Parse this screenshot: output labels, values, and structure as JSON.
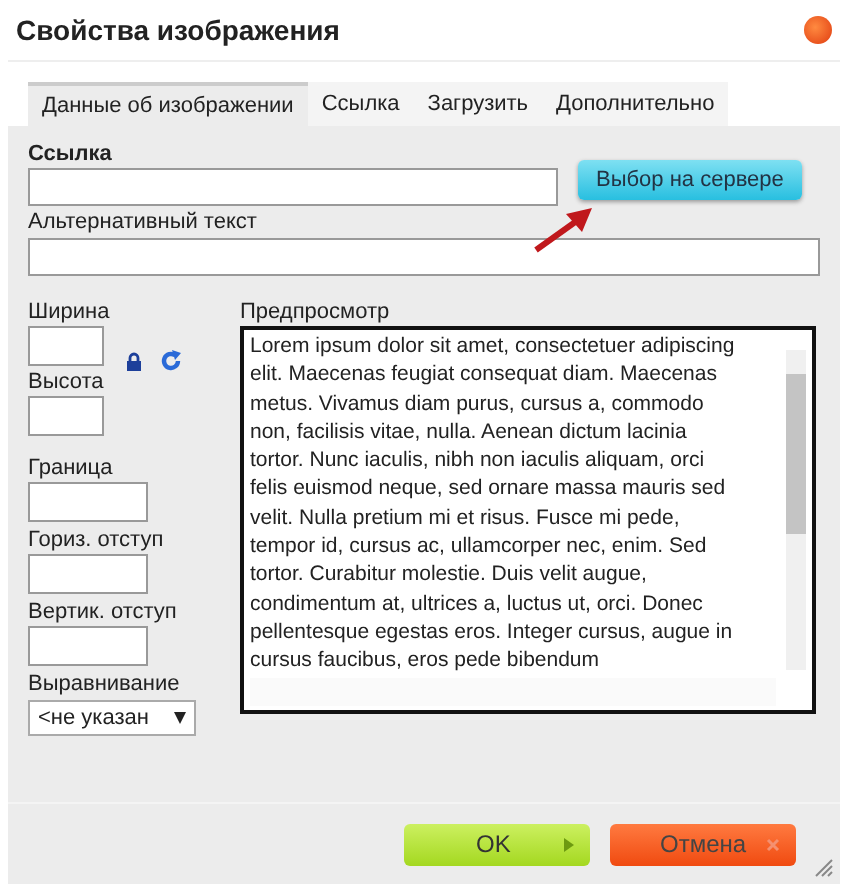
{
  "window": {
    "title": "Свойства изображения"
  },
  "tabs": [
    {
      "label": "Данные об изображении",
      "selected": true
    },
    {
      "label": "Ссылка",
      "selected": false
    },
    {
      "label": "Загрузить",
      "selected": false
    },
    {
      "label": "Дополнительно",
      "selected": false
    }
  ],
  "url": {
    "label": "Ссылка",
    "browse_button": "Выбор на сервере"
  },
  "alt": {
    "label": "Альтернативный текст"
  },
  "fields": [
    {
      "label": "Ширина"
    },
    {
      "label": "Высота"
    },
    {
      "label": "Граница"
    },
    {
      "label": "Гориз. отступ"
    },
    {
      "label": "Вертик. отступ"
    }
  ],
  "align": {
    "label": "Выравнивание",
    "value": "<не указан"
  },
  "preview": {
    "label": "Предпросмотр",
    "text": "Lorem ipsum dolor sit amet, consectetuer adipiscing elit. Maecenas feugiat consequat diam. Maecenas metus. Vivamus diam purus, cursus a, commodo non, facilisis vitae, nulla. Aenean dictum lacinia tortor. Nunc iaculis, nibh non iaculis aliquam, orci felis euismod neque, sed ornare massa mauris sed velit. Nulla pretium mi et risus. Fusce mi pede, tempor id, cursus ac, ullamcorper nec, enim. Sed tortor. Curabitur molestie. Duis velit augue, condimentum at, ultrices a, luctus ut, orci. Donec pellentesque egestas eros. Integer cursus, augue in cursus faucibus, eros pede bibendum"
  },
  "buttons": [
    {
      "label": "OK",
      "kind": "ok"
    },
    {
      "label": "Отмена",
      "kind": "cancel"
    }
  ]
}
